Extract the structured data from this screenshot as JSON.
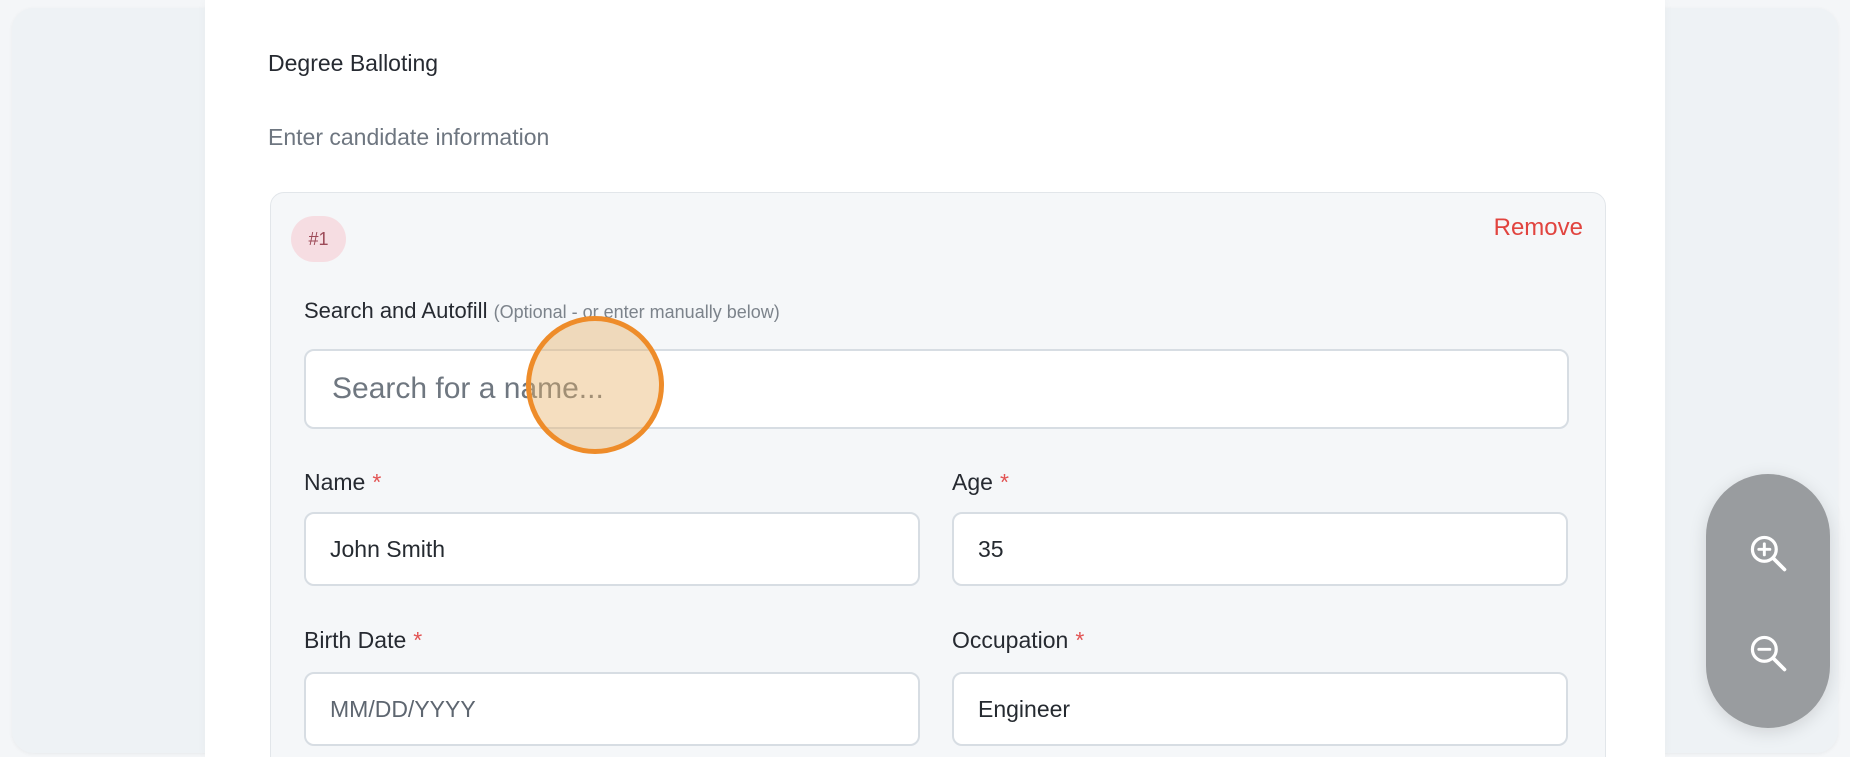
{
  "page": {
    "title": "Degree Balloting",
    "subtitle": "Enter candidate information"
  },
  "candidate": {
    "badge": "#1",
    "remove_label": "Remove",
    "search": {
      "label": "Search and Autofill",
      "hint": "(Optional - or enter manually below)",
      "placeholder": "Search for a name..."
    },
    "fields": {
      "name": {
        "label": "Name",
        "required_marker": "*",
        "value": "John Smith"
      },
      "age": {
        "label": "Age",
        "required_marker": "*",
        "value": "35"
      },
      "birth_date": {
        "label": "Birth Date",
        "required_marker": "*",
        "placeholder": "MM/DD/YYYY"
      },
      "occupation": {
        "label": "Occupation",
        "required_marker": "*",
        "value": "Engineer"
      }
    }
  },
  "zoom_controls": {
    "zoom_in_icon": "zoom-in-icon",
    "zoom_out_icon": "zoom-out-icon"
  },
  "colors": {
    "accent_remove": "#e1443f",
    "required": "#e25353",
    "cursor_ring": "#ee8c2a"
  }
}
